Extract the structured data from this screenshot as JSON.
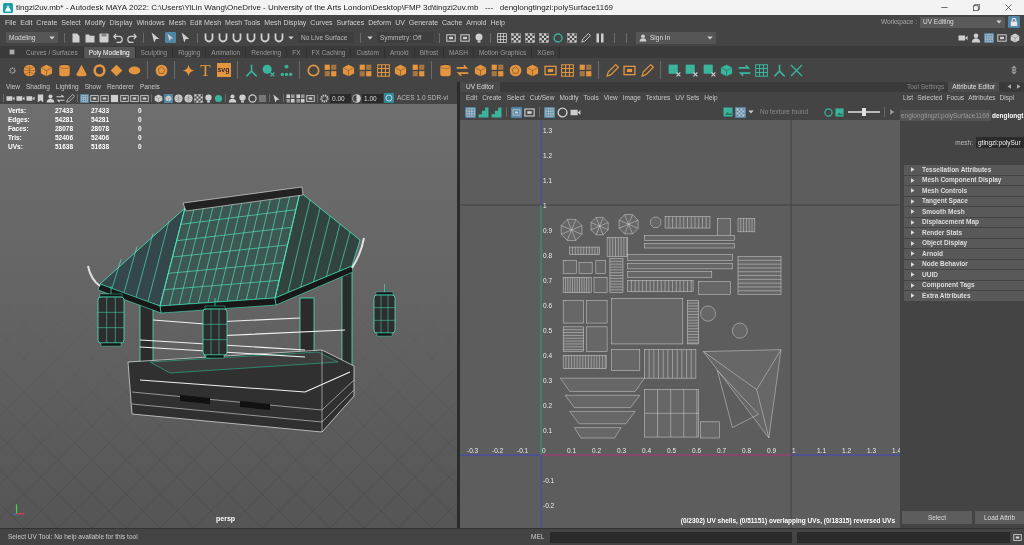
{
  "window": {
    "title": "tingzi2uv.mb* - Autodesk MAYA 2022: C:\\Users\\YiLin Wang\\OneDrive - University of the Arts London\\Desktop\\FMP 3d\\tingzi2uv.mb   ---   denglongtingzi:polySurface1169"
  },
  "menu_bar": {
    "items": [
      "File",
      "Edit",
      "Create",
      "Select",
      "Modify",
      "Display",
      "Windows",
      "Mesh",
      "Edit Mesh",
      "Mesh Tools",
      "Mesh Display",
      "Curves",
      "Surfaces",
      "Deform",
      "UV",
      "Generate",
      "Cache",
      "Arnold",
      "Help"
    ],
    "workspace_label": "Workspace :",
    "workspace": "UV Editing",
    "lock": {
      "on": true
    }
  },
  "status_line": {
    "menu_set": "Modeling",
    "select_modes": [
      {
        "selected": false
      },
      {
        "selected": true
      },
      {
        "selected": false
      }
    ],
    "live_surface": "No Live Surface",
    "symmetry": "Symmetry: Off",
    "account": "Sign In",
    "panel_toggles": [
      {
        "on": false
      },
      {
        "on": false
      },
      {
        "on": true
      },
      {
        "on": false
      },
      {
        "on": false
      }
    ]
  },
  "shelf": {
    "tabs": [
      {
        "label": "Curves / Surfaces",
        "selected": false
      },
      {
        "label": "Poly Modeling",
        "selected": true
      },
      {
        "label": "Sculpting",
        "selected": false
      },
      {
        "label": "Rigging",
        "selected": false
      },
      {
        "label": "Animation",
        "selected": false
      },
      {
        "label": "Rendering",
        "selected": false
      },
      {
        "label": "FX",
        "selected": false
      },
      {
        "label": "FX Caching",
        "selected": false
      },
      {
        "label": "Custom",
        "selected": false
      },
      {
        "label": "Arnold",
        "selected": false
      },
      {
        "label": "Bifrost",
        "selected": false
      },
      {
        "label": "MASH",
        "selected": false
      },
      {
        "label": "Motion Graphics",
        "selected": false
      },
      {
        "label": "XGen",
        "selected": false
      }
    ],
    "text_tool": "T",
    "svg_tool": "svg"
  },
  "viewport": {
    "menu": [
      "View",
      "Shading",
      "Lighting",
      "Show",
      "Renderer",
      "Panels"
    ],
    "display_toggles": [
      {
        "on": true
      },
      {
        "on": false
      },
      {
        "on": false
      },
      {
        "on": false
      },
      {
        "on": false
      },
      {
        "on": false
      },
      {
        "on": false
      }
    ],
    "shading_toggles": [
      {
        "on": false
      },
      {
        "on": true
      },
      {
        "on": false
      },
      {
        "on": false
      },
      {
        "on": false
      },
      {
        "on": false
      },
      {
        "on": false
      }
    ],
    "exposure": "0.00",
    "gamma": "1.00",
    "color_management": {
      "on": true
    },
    "color_space": "ACES 1.0 SDR-vi",
    "stats": [
      {
        "label": "Verts:",
        "values": [
          "27433",
          "27433",
          "0"
        ]
      },
      {
        "label": "Edges:",
        "values": [
          "54281",
          "54281",
          "0"
        ]
      },
      {
        "label": "Faces:",
        "values": [
          "28078",
          "28078",
          "0"
        ]
      },
      {
        "label": "Tris:",
        "values": [
          "52406",
          "52406",
          "0"
        ]
      },
      {
        "label": "UVs:",
        "values": [
          "51638",
          "51638",
          "0"
        ]
      }
    ],
    "camera": "persp"
  },
  "uv_editor": {
    "tab": "UV Editor",
    "menu": [
      "Edit",
      "Create",
      "Select",
      "Cut/Sew",
      "Modify",
      "Tools",
      "View",
      "Image",
      "Textures",
      "UV Sets",
      "Help"
    ],
    "toolbar_toggles": [
      {
        "on": true
      },
      {
        "on": false
      },
      {
        "on": false
      },
      {
        "on": true
      },
      {
        "on": false
      },
      {
        "on": true
      },
      {
        "on": false
      },
      {
        "on": false
      }
    ],
    "checker": {
      "on": true
    },
    "texture": "No texture found",
    "slider": {
      "level": 0.5
    },
    "y_ticks_above": [
      "1.3",
      "1.2",
      "1.1",
      "1",
      "0.9",
      "0.8",
      "0.7",
      "0.6",
      "0.5",
      "0.4",
      "0.3",
      "0.2",
      "0.1"
    ],
    "x_ticks": [
      "-0.3",
      "-0.2",
      "-0.1",
      "0",
      "0.1",
      "0.2",
      "0.3",
      "0.4",
      "0.5",
      "0.6",
      "0.7",
      "0.8",
      "0.9",
      "1",
      "1.1",
      "1.2",
      "1.3",
      "1.4"
    ],
    "y_ticks_below": [
      "-0.1",
      "-0.2"
    ],
    "status": "(0/2302) UV shells, (0/51151) overlapping UVs, (0/18315) reversed UVs"
  },
  "attribute_editor": {
    "tabs": [
      {
        "label": "Tool Settings",
        "selected": false
      },
      {
        "label": "Attribute Editor",
        "selected": true
      }
    ],
    "menu": [
      "List",
      "Selected",
      "Focus",
      "Attributes",
      "Displ"
    ],
    "node_tabs": [
      {
        "label": "englongtingzi:polySurface1169",
        "selected": false
      },
      {
        "label": "denglongt",
        "selected": true
      }
    ],
    "mesh_label": "mesh:",
    "mesh_value": "gtingzi:polySur",
    "sections": [
      {
        "label": "Tessellation Attributes",
        "expanded": false
      },
      {
        "label": "Mesh Component Display",
        "expanded": false
      },
      {
        "label": "Mesh Controls",
        "expanded": false
      },
      {
        "label": "Tangent Space",
        "expanded": false
      },
      {
        "label": "Smooth Mesh",
        "expanded": false
      },
      {
        "label": "Displacement Map",
        "expanded": false
      },
      {
        "label": "Render Stats",
        "expanded": false
      },
      {
        "label": "Object Display",
        "expanded": false
      },
      {
        "label": "Arnold",
        "expanded": false
      },
      {
        "label": "Node Behavior",
        "expanded": false
      },
      {
        "label": "UUID",
        "expanded": false
      },
      {
        "label": "Component Tags",
        "expanded": false
      },
      {
        "label": "Extra Attributes",
        "expanded": false
      }
    ],
    "buttons": [
      "Select",
      "Load Attrib"
    ]
  },
  "help_line": {
    "text": "Select UV Tool: No help available for this tool",
    "command_language": "MEL"
  }
}
